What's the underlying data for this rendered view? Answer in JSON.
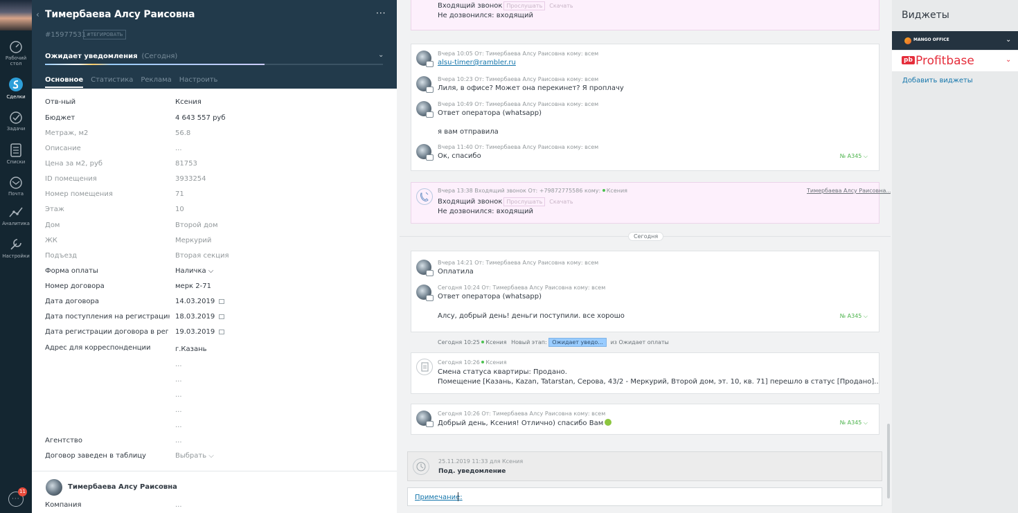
{
  "nav": {
    "items": [
      {
        "label": "Рабочий стол",
        "l1": "Рабочий",
        "l2": "стол"
      },
      {
        "label": "Сделки"
      },
      {
        "label": "Задачи"
      },
      {
        "label": "Списки"
      },
      {
        "label": "Почта"
      },
      {
        "label": "Аналитика"
      },
      {
        "label": "Настройки"
      }
    ],
    "chat_badge": "11"
  },
  "card": {
    "title": "Тимербаева Алсу Раисовна",
    "menu": "···",
    "id": "#15977531",
    "tag_button": "#ТЕГИРОВАТЬ",
    "status": "Ожидает уведомления",
    "status_when": "(Сегодня)",
    "progress_fraction": 0.65,
    "tabs": [
      "Основное",
      "Статистика",
      "Реклама",
      "Настроить"
    ],
    "fields": [
      {
        "label": "Отв-ный",
        "value": "Ксения"
      },
      {
        "label": "Бюджет",
        "value": "4 643 557 руб"
      },
      {
        "label": "Метраж, м2",
        "value": "56.8"
      },
      {
        "label": "Описание",
        "value": "..."
      },
      {
        "label": "Цена за м2, руб",
        "value": "81753"
      },
      {
        "label": "ID помещения",
        "value": "3933254"
      },
      {
        "label": "Номер помещения",
        "value": "71"
      },
      {
        "label": "Этаж",
        "value": "10"
      },
      {
        "label": "Дом",
        "value": "Второй дом"
      },
      {
        "label": "ЖК",
        "value": "Меркурий"
      },
      {
        "label": "Подъезд",
        "value": "Вторая секция"
      },
      {
        "label": "Форма оплаты",
        "value": "Наличка ⌵"
      },
      {
        "label": "Номер договора",
        "value": "мерк 2-71"
      },
      {
        "label": "Дата договора",
        "value": "14.03.2019"
      },
      {
        "label": "Дата поступления на регистрацию",
        "value": "18.03.2019"
      },
      {
        "label": "Дата регистрации договора в регистрации",
        "value": "19.03.2019"
      },
      {
        "label": "Адрес для корреспонденции",
        "value": "г.Казань"
      },
      {
        "label": "",
        "value": "..."
      },
      {
        "label": "",
        "value": "..."
      },
      {
        "label": "",
        "value": "..."
      },
      {
        "label": "",
        "value": "..."
      },
      {
        "label": "",
        "value": "..."
      },
      {
        "label": "Агентство",
        "value": "..."
      },
      {
        "label": "Договор заведен в таблицу",
        "value": "Выбрать ⌵"
      }
    ],
    "contact": {
      "name": "Тимербаева Алсу Раисовна",
      "dots": "···",
      "company_label": "Компания",
      "company_value": "..."
    }
  },
  "feed": {
    "call_top": {
      "text1": "Входящий звонок",
      "listen": "Прослушать",
      "download": "Скачать",
      "text2": "Не дозвонился:  входящий"
    },
    "chat1": [
      {
        "meta": "Вчера 10:05 От: Тимербаева Алсу Раисовна кому: всем",
        "text": "alsu-timer@rambler.ru"
      },
      {
        "meta": "Вчера 10:23 От: Тимербаева Алсу Раисовна кому: всем",
        "text": "Лиля, в офисе? Может она перекинет? Я проплачу"
      },
      {
        "meta": "Вчера 10:49 От: Тимербаева Алсу Раисовна кому: всем",
        "text": "Ответ оператора (whatsapp)",
        "text_b": "я вам отправила"
      },
      {
        "meta": "Вчера 11:40 От: Тимербаева Алсу Раисовна кому: всем",
        "text": "Ок, спасибо"
      }
    ],
    "chat1_num": "№ А345 ⌵",
    "call2": {
      "meta": "Вчера 13:38  Входящий звонок От: +79872775586 кому:",
      "meta_user": "Ксения",
      "contact_link": "Тимербаева Алсу Раисовна...",
      "text1": "Входящий звонок",
      "listen": "Прослушать",
      "download": "Скачать",
      "text2": "Не дозвонился:  входящий"
    },
    "day_label": "Сегодня",
    "chat2": [
      {
        "meta": "Вчера 14:21 От: Тимербаева Алсу Раисовна кому: всем",
        "text": "Оплатила"
      },
      {
        "meta": "Сегодня 10:24 От: Тимербаева Алсу Раисовна кому: всем",
        "text": "Ответ оператора (whatsapp)",
        "text_b": "Алсу, добрый день! деньги поступили. все хорошо"
      }
    ],
    "chat2_num": "№ А345 ⌵",
    "stage_event": {
      "time": "Сегодня 10:25",
      "user": "Ксения",
      "label": "Новый этап:",
      "stage": "Ожидает уведо...",
      "from": "из Ожидает оплаты"
    },
    "system": {
      "meta_time": "Сегодня 10:26",
      "meta_user": "Ксения",
      "text1": "Смена статуса квартиры: Продано.",
      "text2": "Помещение [Казань, Kazan, Tatarstan, Серова, 43/2 - Меркурий, Второй дом, эт. 10, кв. 71] перешло в статус [Продано].."
    },
    "chat3": {
      "meta": "Сегодня 10:26 От: Тимербаева Алсу Раисовна кому: всем",
      "text": "Добрый день, Ксения! Отлично) спасибо Вам"
    },
    "chat3_num": "№ А345 ⌵",
    "task": {
      "meta": "25.11.2019 11:33 для Ксения",
      "text": "Под. уведомление"
    },
    "compose_label": "Примечание:"
  },
  "widgets": {
    "title": "Виджеты",
    "mango": "MANGO OFFICE",
    "profit_mark": "pb",
    "profit": "Profitbase",
    "add": "Добавить виджеты"
  }
}
